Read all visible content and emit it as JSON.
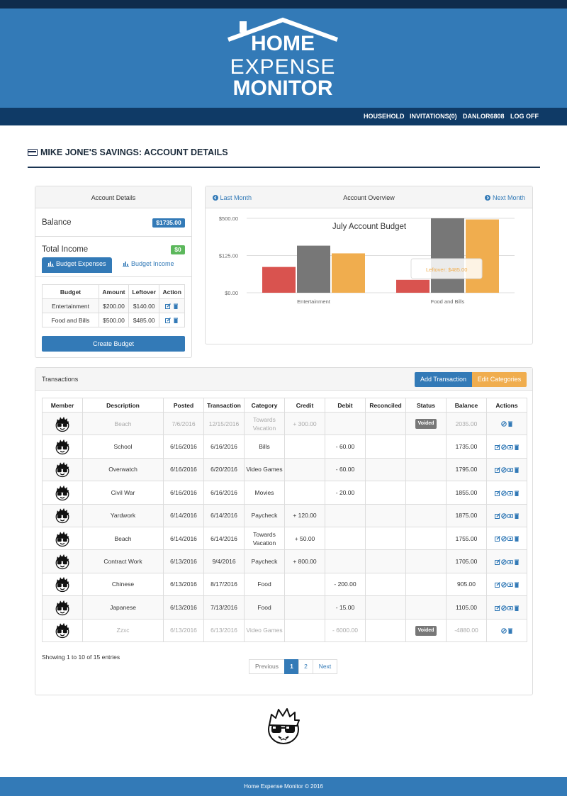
{
  "app": {
    "logo_line1": "HOME",
    "logo_line2": "EXPENSE",
    "logo_line3": "MONITOR"
  },
  "nav": {
    "items": [
      "HOUSEHOLD",
      "INVITATIONS(0)",
      "DANLOR6808",
      "LOG OFF"
    ]
  },
  "page": {
    "title": "MIKE JONE'S SAVINGS: ACCOUNT DETAILS"
  },
  "account_details": {
    "heading": "Account Details",
    "balance_label": "Balance",
    "balance_value": "$1735.00",
    "income_label": "Total Income",
    "income_value": "$0",
    "tab_expenses": "Budget Expenses",
    "tab_income": "Budget Income",
    "budget_headers": [
      "Budget",
      "Amount",
      "Leftover",
      "Action"
    ],
    "budget_rows": [
      {
        "name": "Entertainment",
        "amount": "$200.00",
        "leftover": "$140.00"
      },
      {
        "name": "Food and Bills",
        "amount": "$500.00",
        "leftover": "$485.00"
      }
    ],
    "create_button": "Create Budget"
  },
  "overview": {
    "prev_label": "Last Month",
    "heading": "Account Overview",
    "next_label": "Next Month"
  },
  "chart_data": {
    "type": "bar",
    "title": "July Account Budget",
    "categories": [
      "Entertainment",
      "Food and Bills"
    ],
    "y_tick_labels": [
      "$500.00",
      "$125.00",
      "$0.00"
    ],
    "series": [
      {
        "values": [
          60,
          15
        ],
        "color": "#d9534f"
      },
      {
        "values": [
          200,
          500
        ],
        "color": "#777777"
      },
      {
        "values": [
          140,
          485
        ],
        "color": "#f0ad4e"
      }
    ],
    "tooltip": "Leftover: $485.00",
    "scale": "sqrt",
    "ylim": [
      0,
      500
    ],
    "grid": true
  },
  "transactions": {
    "heading": "Transactions",
    "add_button": "Add Transaction",
    "categories_button": "Edit Categories",
    "headers": [
      "Member",
      "Description",
      "Posted",
      "Transaction",
      "Category",
      "Credit",
      "Debit",
      "Reconciled",
      "Status",
      "Balance",
      "Actions"
    ],
    "rows": [
      {
        "description": "Beach",
        "posted": "7/6/2016",
        "transaction": "12/15/2016",
        "category": "Towards Vacation",
        "credit": "+ 300.00",
        "debit": "",
        "reconciled": "",
        "status": "Voided",
        "balance": "2035.00",
        "voided": true
      },
      {
        "description": "School",
        "posted": "6/16/2016",
        "transaction": "6/16/2016",
        "category": "Bills",
        "credit": "",
        "debit": "- 60.00",
        "reconciled": "",
        "status": "",
        "balance": "1735.00",
        "voided": false
      },
      {
        "description": "Overwatch",
        "posted": "6/16/2016",
        "transaction": "6/20/2016",
        "category": "Video Games",
        "credit": "",
        "debit": "- 60.00",
        "reconciled": "",
        "status": "",
        "balance": "1795.00",
        "voided": false
      },
      {
        "description": "Civil War",
        "posted": "6/16/2016",
        "transaction": "6/16/2016",
        "category": "Movies",
        "credit": "",
        "debit": "- 20.00",
        "reconciled": "",
        "status": "",
        "balance": "1855.00",
        "voided": false
      },
      {
        "description": "Yardwork",
        "posted": "6/14/2016",
        "transaction": "6/14/2016",
        "category": "Paycheck",
        "credit": "+ 120.00",
        "debit": "",
        "reconciled": "",
        "status": "",
        "balance": "1875.00",
        "voided": false
      },
      {
        "description": "Beach",
        "posted": "6/14/2016",
        "transaction": "6/14/2016",
        "category": "Towards Vacation",
        "credit": "+ 50.00",
        "debit": "",
        "reconciled": "",
        "status": "",
        "balance": "1755.00",
        "voided": false
      },
      {
        "description": "Contract Work",
        "posted": "6/13/2016",
        "transaction": "9/4/2016",
        "category": "Paycheck",
        "credit": "+ 800.00",
        "debit": "",
        "reconciled": "",
        "status": "",
        "balance": "1705.00",
        "voided": false
      },
      {
        "description": "Chinese",
        "posted": "6/13/2016",
        "transaction": "8/17/2016",
        "category": "Food",
        "credit": "",
        "debit": "- 200.00",
        "reconciled": "",
        "status": "",
        "balance": "905.00",
        "voided": false
      },
      {
        "description": "Japanese",
        "posted": "6/13/2016",
        "transaction": "7/13/2016",
        "category": "Food",
        "credit": "",
        "debit": "- 15.00",
        "reconciled": "",
        "status": "",
        "balance": "1105.00",
        "voided": false
      },
      {
        "description": "Zzxc",
        "posted": "6/13/2016",
        "transaction": "6/13/2016",
        "category": "Video Games",
        "credit": "",
        "debit": "- 6000.00",
        "reconciled": "",
        "status": "Voided",
        "balance": "-4880.00",
        "voided": true
      }
    ],
    "showing_text": "Showing 1 to 10 of 15 entries",
    "pager": {
      "previous": "Previous",
      "pages": [
        "1",
        "2"
      ],
      "next": "Next",
      "active": "1"
    }
  },
  "footer": {
    "text": "Home Expense Monitor © 2016"
  }
}
